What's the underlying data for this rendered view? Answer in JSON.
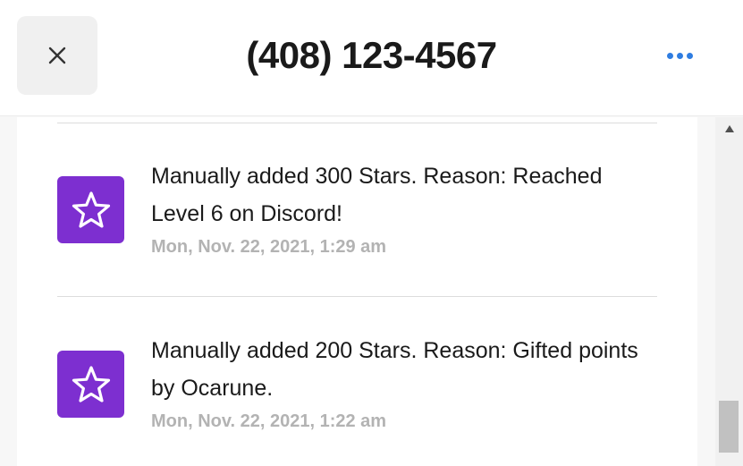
{
  "header": {
    "title": "(408) 123-4567",
    "close_icon": "close-icon",
    "more_icon": "more-horizontal-icon"
  },
  "activity": [
    {
      "icon": "star-icon",
      "text": "Manually added 300 Stars. Reason: Reached Level 6 on Discord!",
      "date": "Mon, Nov. 22, 2021, 1:29 am"
    },
    {
      "icon": "star-icon",
      "text": "Manually added 200 Stars. Reason: Gifted points by Ocarune.",
      "date": "Mon, Nov. 22, 2021, 1:22 am"
    }
  ],
  "colors": {
    "accent": "#2f7de1",
    "star_tile": "#7d2fd0",
    "date_text": "#b3b3b3"
  }
}
